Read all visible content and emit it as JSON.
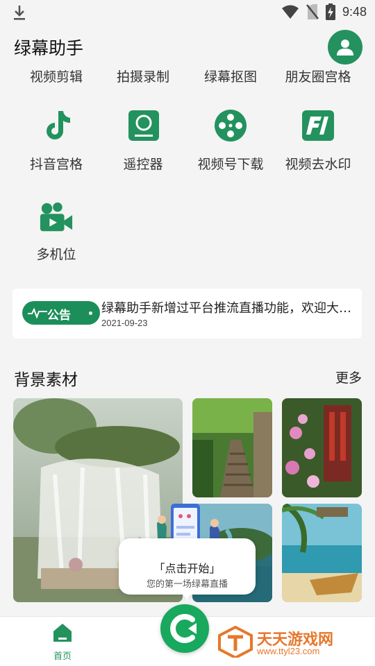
{
  "status_bar": {
    "time": "9:48",
    "icons": [
      "download-icon",
      "wifi-icon",
      "no-sim-icon",
      "battery-charging-icon"
    ]
  },
  "header": {
    "app_title": "绿幕助手",
    "avatar_icon": "user-icon"
  },
  "top_tools": [
    "视频剪辑",
    "拍摄录制",
    "绿幕抠图",
    "朋友圈宫格"
  ],
  "tools": [
    {
      "label": "抖音宫格",
      "icon": "tiktok-icon"
    },
    {
      "label": "遥控器",
      "icon": "remote-icon"
    },
    {
      "label": "视频号下载",
      "icon": "film-reel-icon"
    },
    {
      "label": "视频去水印",
      "icon": "watermark-remove-icon"
    },
    {
      "label": "多机位",
      "icon": "video-camera-icon"
    }
  ],
  "notice": {
    "badge": "公告",
    "text": "绿幕助手新增过平台推流直播功能，欢迎大家体验使用",
    "date": "2021-09-23"
  },
  "background_section": {
    "title": "背景素材",
    "more": "更多"
  },
  "popup": {
    "title": "「点击开始」",
    "subtitle": "您的第一场绿幕直播"
  },
  "bottom_nav": {
    "home_label": "首页",
    "home_icon": "home-icon",
    "center_icon": "start-live-icon"
  },
  "watermark": {
    "title": "天天游戏网",
    "url": "www.ttyl23.com"
  },
  "colors": {
    "brand": "#23925e",
    "fab": "#18a85e",
    "watermark": "#e7772a"
  }
}
